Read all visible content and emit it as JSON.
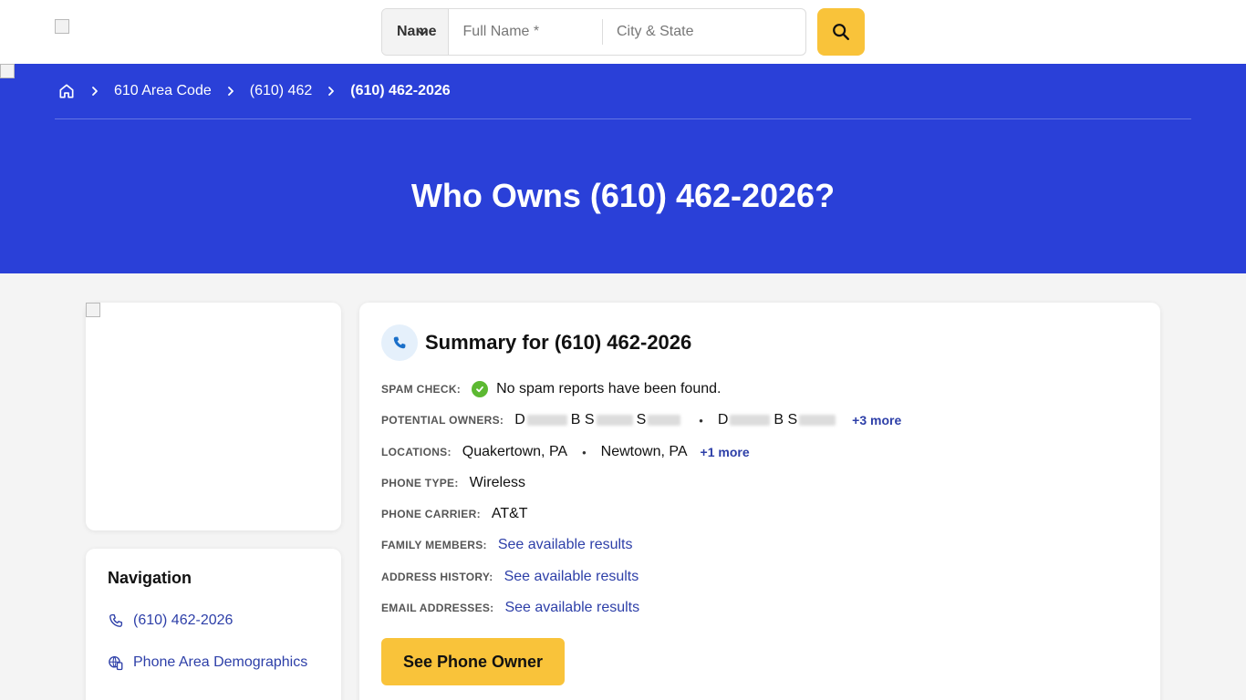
{
  "header": {
    "search_type": "Name",
    "full_name_placeholder": "Full Name *",
    "city_state_placeholder": "City & State"
  },
  "breadcrumb": {
    "items": [
      "610 Area Code",
      "(610) 462"
    ],
    "current": "(610) 462-2026"
  },
  "hero": {
    "title": "Who Owns (610) 462-2026?"
  },
  "navigation": {
    "title": "Navigation",
    "items": [
      "(610) 462-2026",
      "Phone Area Demographics"
    ]
  },
  "summary": {
    "title": "Summary for (610) 462-2026",
    "spam_label": "SPAM CHECK:",
    "spam_value": "No spam reports have been found.",
    "owners_label": "POTENTIAL OWNERS:",
    "owners": [
      {
        "parts": [
          "D",
          "B S",
          "S"
        ]
      },
      {
        "parts": [
          "D",
          "B S"
        ]
      }
    ],
    "owners_more": "+3 more",
    "locations_label": "LOCATIONS:",
    "locations": [
      "Quakertown, PA",
      "Newtown, PA"
    ],
    "locations_more": "+1 more",
    "phone_type_label": "PHONE TYPE:",
    "phone_type": "Wireless",
    "carrier_label": "PHONE CARRIER:",
    "carrier": "AT&T",
    "family_label": "FAMILY MEMBERS:",
    "address_label": "ADDRESS HISTORY:",
    "email_label": "EMAIL ADDRESSES:",
    "see_results": "See available results",
    "cta": "See Phone Owner"
  },
  "colors": {
    "hero_blue": "#2a40d8",
    "accent_yellow": "#f9c33a",
    "link_blue": "#2d3fa8",
    "check_green": "#5cb932"
  }
}
